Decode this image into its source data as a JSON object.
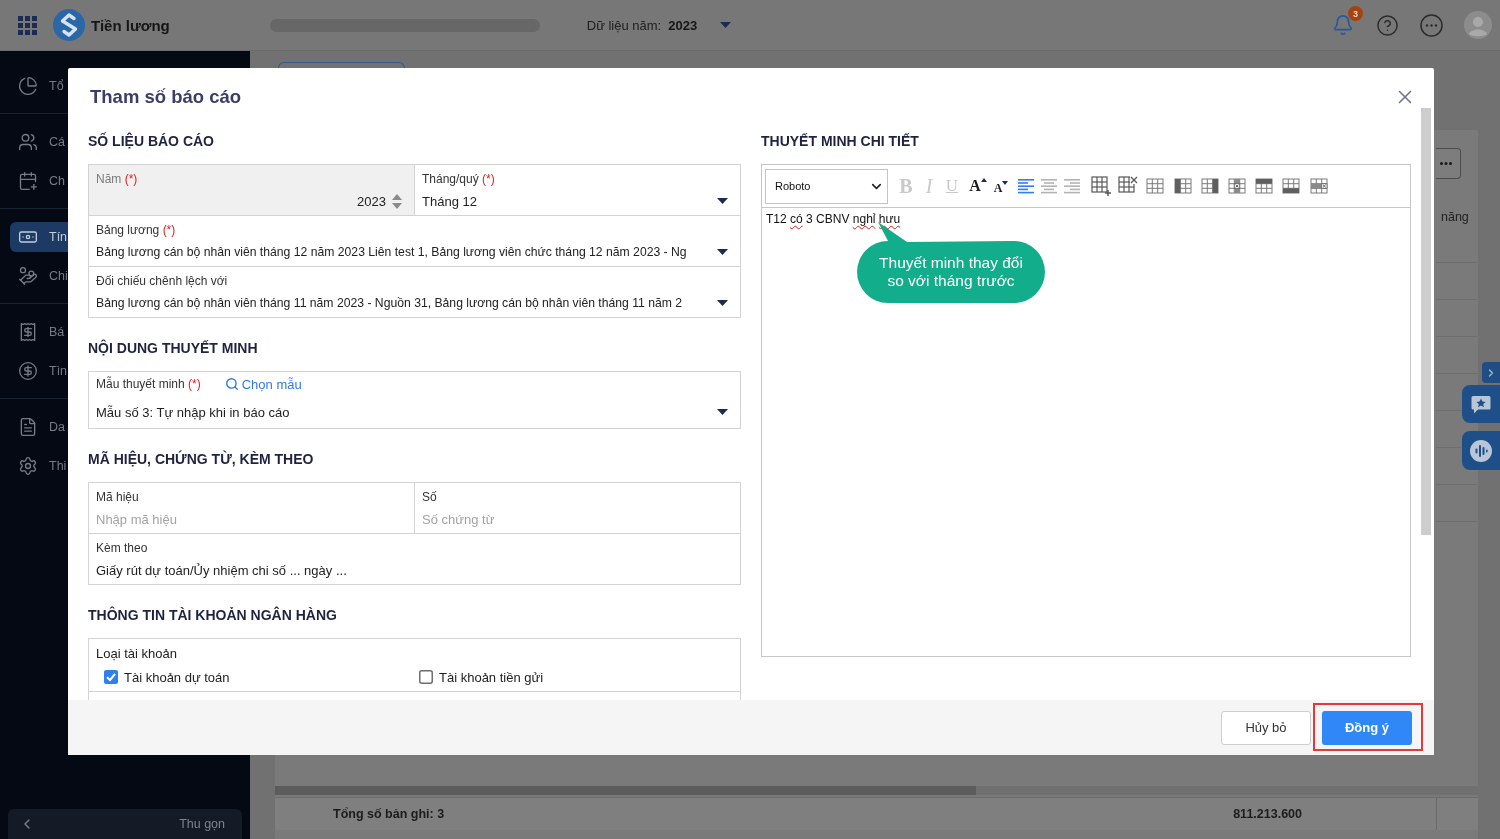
{
  "topbar": {
    "app_name": "Tiền lương",
    "year_label": "Dữ liệu năm:",
    "year_value": "2023",
    "notification_count": "3"
  },
  "sidebar": {
    "groups": [
      {
        "items": [
          {
            "label": "Tổ",
            "selected": false
          }
        ]
      },
      {
        "items": [
          {
            "label": "Cá",
            "selected": false
          },
          {
            "label": "Ch",
            "selected": false
          }
        ]
      },
      {
        "items": [
          {
            "label": "Tín",
            "selected": true
          },
          {
            "label": "Chi",
            "selected": false
          }
        ]
      },
      {
        "items": [
          {
            "label": "Bá",
            "selected": false
          },
          {
            "label": "Tìn",
            "selected": false
          }
        ]
      },
      {
        "items": [
          {
            "label": "Da",
            "selected": false
          },
          {
            "label": "Thi",
            "selected": false
          }
        ]
      }
    ],
    "collapse_label": "Thu gọn"
  },
  "table": {
    "column_header": "năng",
    "footer_label": "Tổng số bản ghi: 3",
    "footer_total": "811.213.600"
  },
  "dialog": {
    "title": "Tham số báo cáo",
    "report_data": {
      "heading": "SỐ LIỆU BÁO CÁO",
      "year": {
        "label": "Năm",
        "required_mark": "(*)",
        "value": "2023",
        "disabled": true
      },
      "period": {
        "label": "Tháng/quý",
        "required_mark": "(*)",
        "value": "Tháng 12"
      },
      "payroll": {
        "label": "Bảng lương",
        "required_mark": "(*)",
        "value": "Bảng lương cán bộ nhân viên tháng 12 năm 2023 Liên test 1, Bảng lương viên chức tháng 12 năm 2023 - Ng"
      },
      "compare_with": {
        "label": "Đối chiếu chênh lệch với",
        "value": "Bảng lương cán bộ nhân viên tháng 11 năm 2023 - Nguồn 31, Bảng lương cán bộ nhân viên tháng 11 năm 2"
      }
    },
    "explanation": {
      "heading": "NỘI DUNG THUYẾT MINH",
      "template": {
        "label": "Mẫu thuyết minh",
        "required_mark": "(*)",
        "link": "Chọn mẫu",
        "value": "Mẫu số 3: Tự nhập khi in báo cáo"
      }
    },
    "documents": {
      "heading": "MÃ HIỆU, CHỨNG TỪ, KÈM THEO",
      "code": {
        "label": "Mã hiệu",
        "placeholder": "Nhập mã hiệu"
      },
      "number": {
        "label": "Số",
        "placeholder": "Số chứng từ"
      },
      "attachment": {
        "label": "Kèm theo",
        "value": "Giấy rút dự toán/Ủy nhiệm chi số ... ngày ..."
      }
    },
    "bank": {
      "heading": "THÔNG TIN TÀI KHOẢN NGÂN HÀNG",
      "account_type": {
        "label": "Loại tài khoản",
        "options": [
          {
            "label": "Tài khoản dự toán",
            "checked": true
          },
          {
            "label": "Tài khoản tiền gửi",
            "checked": false
          }
        ]
      }
    },
    "details": {
      "heading": "THUYẾT MINH CHI TIẾT",
      "font": "Roboto",
      "format_tools": [
        {
          "kind": "bold",
          "label": "B",
          "disabled": true
        },
        {
          "kind": "italic",
          "label": "I",
          "disabled": true
        },
        {
          "kind": "underline",
          "label": "U",
          "disabled": true
        },
        {
          "kind": "font_grow",
          "label": "A",
          "disabled": false
        },
        {
          "kind": "font_shrink",
          "label": "A",
          "disabled": false
        }
      ],
      "align_tools": [
        {
          "kind": "left",
          "selected": true
        },
        {
          "kind": "center",
          "selected": false
        },
        {
          "kind": "right",
          "selected": false
        }
      ],
      "table_tools": [
        {
          "kind": "insert_table"
        },
        {
          "kind": "delete_table"
        },
        {
          "kind": "table"
        },
        {
          "kind": "column_left"
        },
        {
          "kind": "column_right"
        },
        {
          "kind": "delete_column"
        },
        {
          "kind": "row_above"
        },
        {
          "kind": "row_below"
        },
        {
          "kind": "delete_row"
        }
      ],
      "content": [
        {
          "word": "T12",
          "spell_error": false
        },
        {
          "word": "có",
          "spell_error": true
        },
        {
          "word": "3",
          "spell_error": false
        },
        {
          "word": "CBNV",
          "spell_error": false
        },
        {
          "word": "nghỉ",
          "spell_error": true
        },
        {
          "word": "hưu",
          "spell_error": true
        }
      ],
      "callout": {
        "lines": [
          "Thuyết minh thay đổi",
          "so với tháng trước"
        ]
      }
    },
    "footer": {
      "buttons": [
        {
          "label": "Hủy bỏ",
          "kind": "secondary",
          "highlighted": false
        },
        {
          "label": "Đồng ý",
          "kind": "primary",
          "highlighted": true
        }
      ]
    }
  }
}
